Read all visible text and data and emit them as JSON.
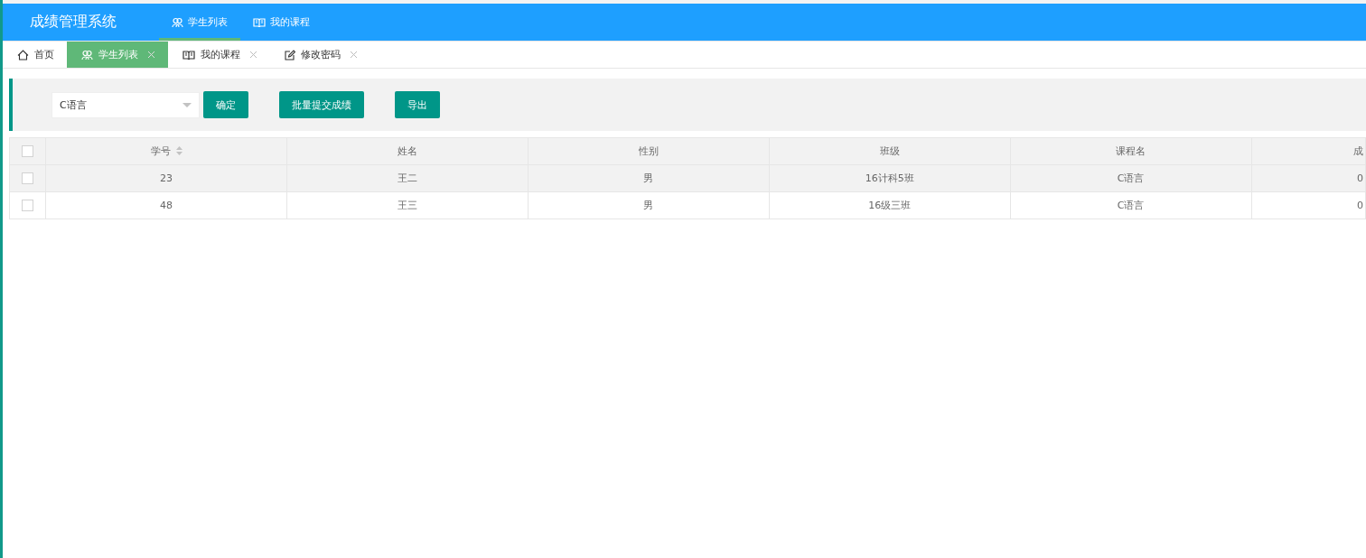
{
  "header": {
    "title": "成绩管理系统",
    "nav": [
      {
        "label": "学生列表",
        "kind": "users",
        "selected": true
      },
      {
        "label": "我的课程",
        "kind": "book",
        "selected": false
      }
    ]
  },
  "tabs": [
    {
      "label": "首页",
      "kind": "home",
      "closable": false,
      "selected": false
    },
    {
      "label": "学生列表",
      "kind": "users",
      "closable": true,
      "selected": true
    },
    {
      "label": "我的课程",
      "kind": "book",
      "closable": true,
      "selected": false
    },
    {
      "label": "修改密码",
      "kind": "edit",
      "closable": true,
      "selected": false
    }
  ],
  "toolbar": {
    "course_select": {
      "value": "C语言"
    },
    "buttons": [
      "确定",
      "批量提交成绩",
      "导出"
    ]
  },
  "table": {
    "columns": [
      {
        "label": "学号",
        "sortable": true
      },
      {
        "label": "姓名",
        "sortable": false
      },
      {
        "label": "性别",
        "sortable": false
      },
      {
        "label": "班级",
        "sortable": false
      },
      {
        "label": "课程名",
        "sortable": false
      },
      {
        "label": "成",
        "sortable": false
      }
    ],
    "all_checked": false,
    "rows": [
      {
        "checked": false,
        "hovered": true,
        "cells": [
          "23",
          "王二",
          "男",
          "16计科5班",
          "C语言",
          "0"
        ]
      },
      {
        "checked": false,
        "hovered": false,
        "cells": [
          "48",
          "王三",
          "男",
          "16级三班",
          "C语言",
          "0"
        ]
      }
    ]
  }
}
